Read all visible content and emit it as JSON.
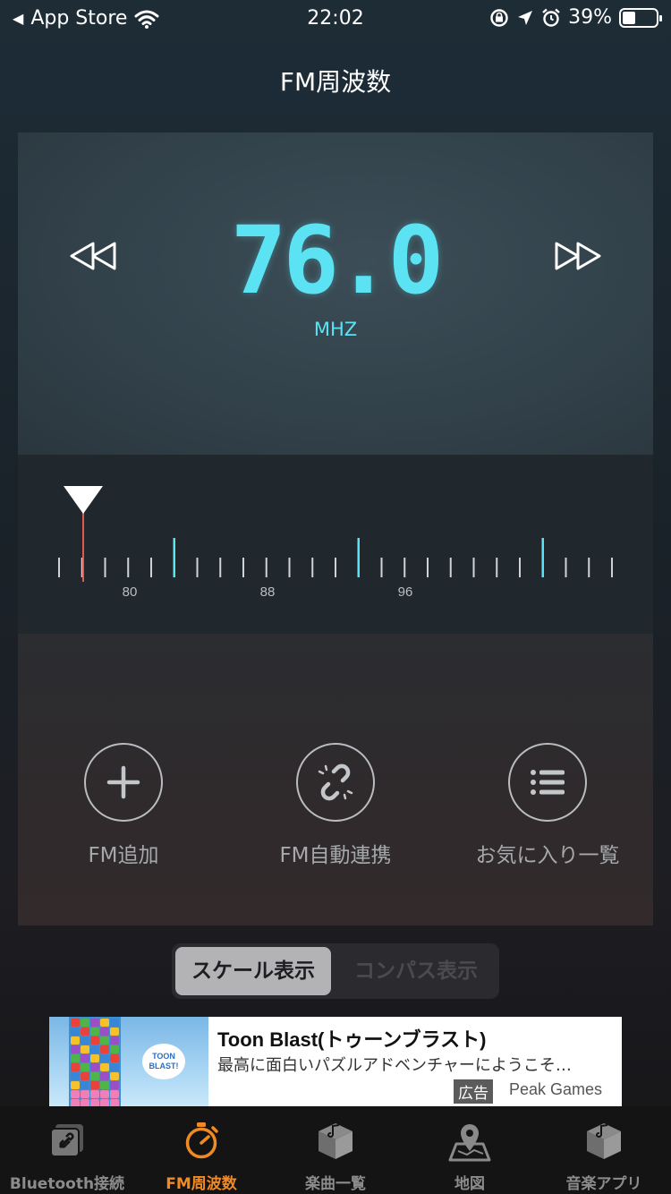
{
  "status_bar": {
    "back_label": "App Store",
    "time": "22:02",
    "battery_percent": "39%",
    "battery_level": 0.39
  },
  "header": {
    "title": "FM周波数"
  },
  "tuner": {
    "frequency": "76.0",
    "unit": "MHZ",
    "scale_labels": [
      "80",
      "88",
      "96"
    ],
    "needle_value": 76.0
  },
  "controls": {
    "add": "FM追加",
    "auto_link": "FM自動連携",
    "favorites": "お気に入り一覧"
  },
  "toggle": {
    "scale": "スケール表示",
    "compass": "コンパス表示"
  },
  "ad": {
    "title": "Toon Blast(トゥーンブラスト)",
    "description": "最高に面白いパズルアドベンチャーにようこそ…",
    "badge": "広告",
    "advertiser": "Peak Games",
    "logo_text": "TOON BLAST!"
  },
  "tabs": [
    {
      "label": "Bluetooth接続",
      "icon": "link-icon"
    },
    {
      "label": "FM周波数",
      "icon": "stopwatch-icon"
    },
    {
      "label": "楽曲一覧",
      "icon": "music-box-icon"
    },
    {
      "label": "地図",
      "icon": "map-pin-icon"
    },
    {
      "label": "音楽アプリ",
      "icon": "music-box-icon"
    }
  ],
  "colors": {
    "accent": "#5be3f3",
    "tab_active": "#f08a24",
    "needle": "#e05a4f"
  }
}
